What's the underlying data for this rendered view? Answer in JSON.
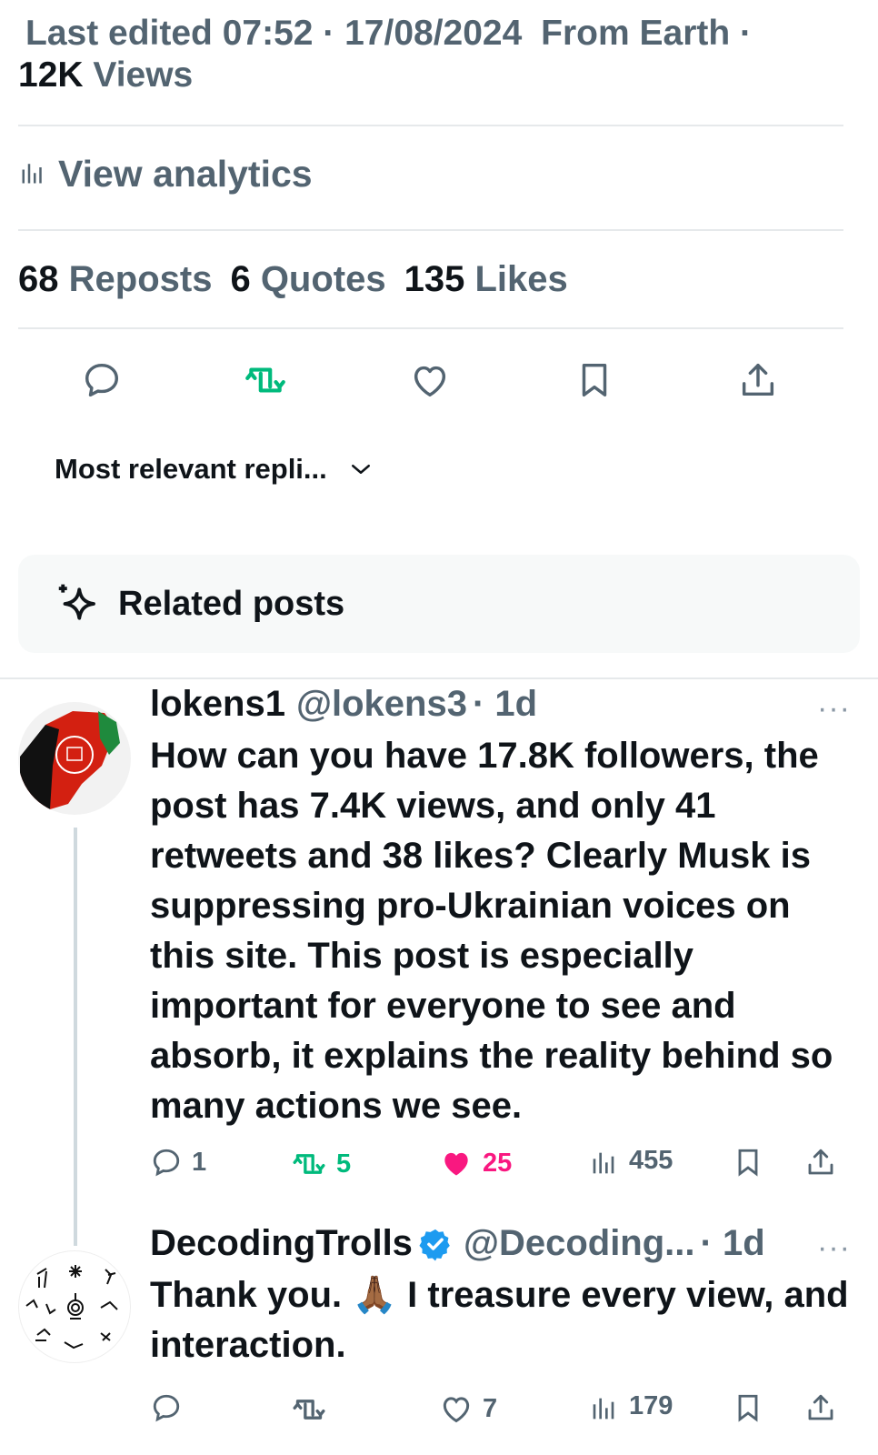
{
  "post_meta": {
    "last_edited": "Last edited 07:52 · 17/08/2024",
    "location": "From Earth ·",
    "views_count": "12K",
    "views_label": "Views"
  },
  "analytics": {
    "label": "View analytics"
  },
  "stats": {
    "reposts_count": "68",
    "reposts_label": "Reposts",
    "quotes_count": "6",
    "quotes_label": "Quotes",
    "likes_count": "135",
    "likes_label": "Likes"
  },
  "sort": {
    "label": "Most relevant repli..."
  },
  "related": {
    "label": "Related posts"
  },
  "colors": {
    "repost_green": "#00ba7c",
    "like_pink": "#f91880",
    "verified_blue": "#1d9bf0",
    "muted": "#536471"
  },
  "replies": [
    {
      "name": "lokens1",
      "handle": "@lokens3",
      "time": "· 1d",
      "more": "···",
      "text": "How can you have 17.8K followers, the post has 7.4K views, and only 41 retweets and 38 likes? Clearly Musk is suppressing pro-Ukrainian voices on this site. This post is especially important for everyone to see and absorb, it explains the reality behind so many actions we see.",
      "reply_count": "1",
      "repost_count": "5",
      "like_count": "25",
      "views": "455",
      "liked": true,
      "reposted": true
    },
    {
      "name": "DecodingTrolls",
      "verified": true,
      "handle": "@Decoding...",
      "time": "· 1d",
      "more": "···",
      "text": "Thank you. 🙏🏾 I treasure every view, and interaction.",
      "reply_count": "",
      "repost_count": "",
      "like_count": "7",
      "views": "179",
      "liked": false,
      "reposted": false
    }
  ]
}
